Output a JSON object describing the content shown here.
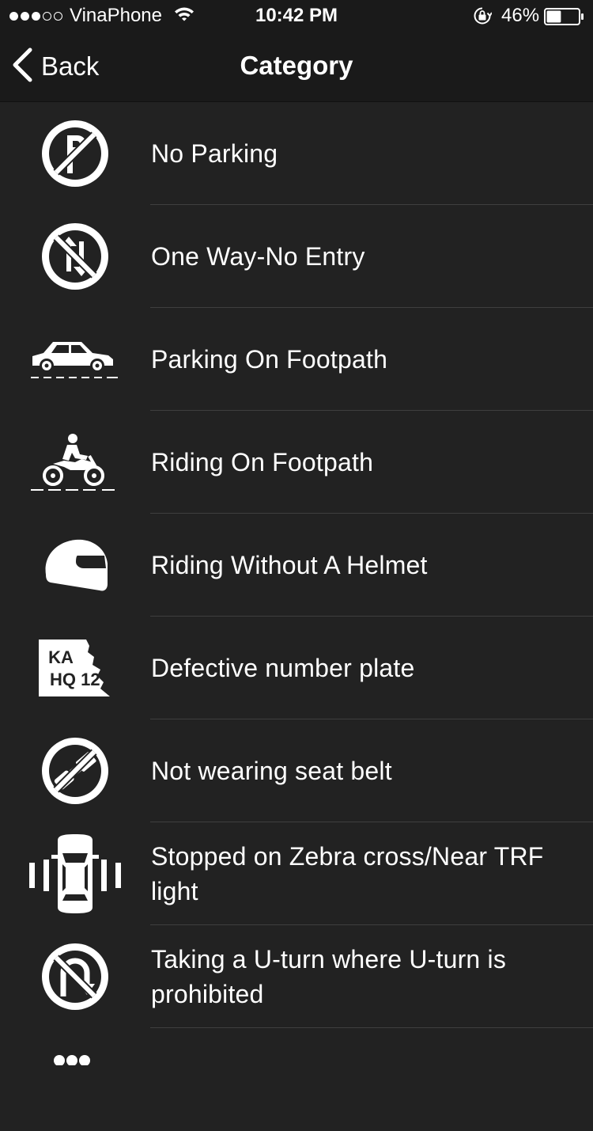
{
  "status_bar": {
    "carrier": "VinaPhone",
    "time": "10:42 PM",
    "battery_percent": "46%",
    "battery_level": 0.46,
    "signal_bars_filled": 3,
    "signal_bars_total": 5
  },
  "nav": {
    "back_label": "Back",
    "title": "Category"
  },
  "categories": [
    {
      "label": "No Parking",
      "icon": "no-parking-icon"
    },
    {
      "label": "One Way-No Entry",
      "icon": "one-way-no-entry-icon"
    },
    {
      "label": "Parking On Footpath",
      "icon": "car-on-footpath-icon"
    },
    {
      "label": "Riding On Footpath",
      "icon": "motorbike-on-footpath-icon"
    },
    {
      "label": "Riding Without A Helmet",
      "icon": "helmet-icon"
    },
    {
      "label": "Defective number plate",
      "icon": "number-plate-icon",
      "plate_text": [
        "KA",
        "HQ 12"
      ]
    },
    {
      "label": "Not wearing seat belt",
      "icon": "no-seat-belt-icon"
    },
    {
      "label": "Stopped on Zebra cross/Near TRF light",
      "icon": "car-on-zebra-crossing-icon"
    },
    {
      "label": "Taking a U-turn where U-turn is prohibited",
      "icon": "no-u-turn-icon"
    }
  ],
  "colors": {
    "background": "#222222",
    "bar_background": "#1a1a1a",
    "divider": "#3f3f3f",
    "text": "#ffffff"
  }
}
